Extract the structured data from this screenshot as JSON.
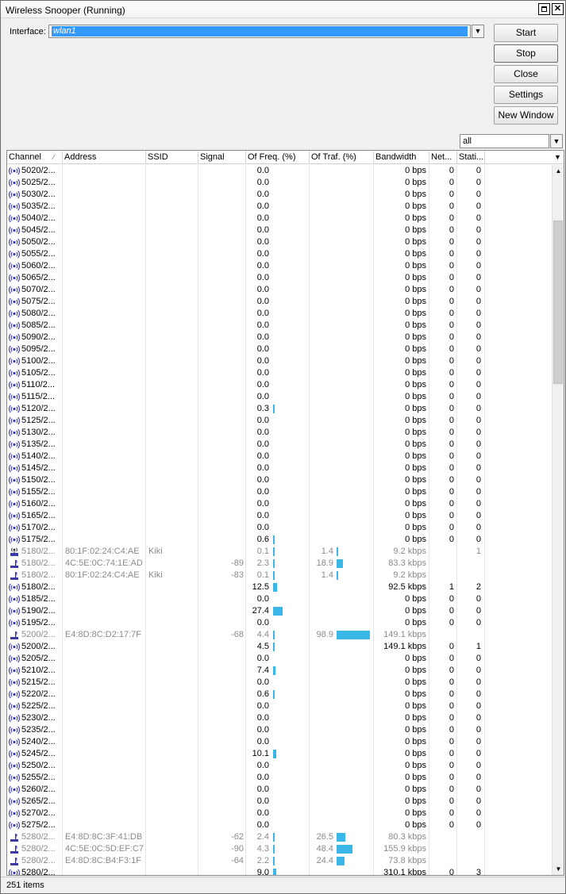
{
  "window": {
    "title": "Wireless Snooper (Running)",
    "interface_label": "Interface:",
    "interface_value": "wlan1",
    "filter_value": "all",
    "status": "251 items"
  },
  "buttons": {
    "start": "Start",
    "stop": "Stop",
    "close": "Close",
    "settings": "Settings",
    "new_window": "New Window"
  },
  "columns": [
    "Channel",
    "Address",
    "SSID",
    "Signal",
    "Of Freq. (%)",
    "Of Traf. (%)",
    "Bandwidth",
    "Net...",
    "Stati..."
  ],
  "colors": {
    "bar": "#3ab7e6",
    "selection": "#3399ff",
    "dim_text": "#8a8a8a"
  },
  "icons": {
    "channel": "antenna-icon",
    "access_point": "access-point-icon",
    "station": "station-icon"
  },
  "rows": [
    {
      "channel": "5020/2...",
      "address": "",
      "ssid": "",
      "signal": "",
      "freq": "0.0",
      "traf": "",
      "bandwidth": "0 bps",
      "net": "0",
      "sta": "0",
      "kind": "channel"
    },
    {
      "channel": "5025/2...",
      "address": "",
      "ssid": "",
      "signal": "",
      "freq": "0.0",
      "traf": "",
      "bandwidth": "0 bps",
      "net": "0",
      "sta": "0",
      "kind": "channel"
    },
    {
      "channel": "5030/2...",
      "address": "",
      "ssid": "",
      "signal": "",
      "freq": "0.0",
      "traf": "",
      "bandwidth": "0 bps",
      "net": "0",
      "sta": "0",
      "kind": "channel"
    },
    {
      "channel": "5035/2...",
      "address": "",
      "ssid": "",
      "signal": "",
      "freq": "0.0",
      "traf": "",
      "bandwidth": "0 bps",
      "net": "0",
      "sta": "0",
      "kind": "channel"
    },
    {
      "channel": "5040/2...",
      "address": "",
      "ssid": "",
      "signal": "",
      "freq": "0.0",
      "traf": "",
      "bandwidth": "0 bps",
      "net": "0",
      "sta": "0",
      "kind": "channel"
    },
    {
      "channel": "5045/2...",
      "address": "",
      "ssid": "",
      "signal": "",
      "freq": "0.0",
      "traf": "",
      "bandwidth": "0 bps",
      "net": "0",
      "sta": "0",
      "kind": "channel"
    },
    {
      "channel": "5050/2...",
      "address": "",
      "ssid": "",
      "signal": "",
      "freq": "0.0",
      "traf": "",
      "bandwidth": "0 bps",
      "net": "0",
      "sta": "0",
      "kind": "channel"
    },
    {
      "channel": "5055/2...",
      "address": "",
      "ssid": "",
      "signal": "",
      "freq": "0.0",
      "traf": "",
      "bandwidth": "0 bps",
      "net": "0",
      "sta": "0",
      "kind": "channel"
    },
    {
      "channel": "5060/2...",
      "address": "",
      "ssid": "",
      "signal": "",
      "freq": "0.0",
      "traf": "",
      "bandwidth": "0 bps",
      "net": "0",
      "sta": "0",
      "kind": "channel"
    },
    {
      "channel": "5065/2...",
      "address": "",
      "ssid": "",
      "signal": "",
      "freq": "0.0",
      "traf": "",
      "bandwidth": "0 bps",
      "net": "0",
      "sta": "0",
      "kind": "channel"
    },
    {
      "channel": "5070/2...",
      "address": "",
      "ssid": "",
      "signal": "",
      "freq": "0.0",
      "traf": "",
      "bandwidth": "0 bps",
      "net": "0",
      "sta": "0",
      "kind": "channel"
    },
    {
      "channel": "5075/2...",
      "address": "",
      "ssid": "",
      "signal": "",
      "freq": "0.0",
      "traf": "",
      "bandwidth": "0 bps",
      "net": "0",
      "sta": "0",
      "kind": "channel"
    },
    {
      "channel": "5080/2...",
      "address": "",
      "ssid": "",
      "signal": "",
      "freq": "0.0",
      "traf": "",
      "bandwidth": "0 bps",
      "net": "0",
      "sta": "0",
      "kind": "channel"
    },
    {
      "channel": "5085/2...",
      "address": "",
      "ssid": "",
      "signal": "",
      "freq": "0.0",
      "traf": "",
      "bandwidth": "0 bps",
      "net": "0",
      "sta": "0",
      "kind": "channel"
    },
    {
      "channel": "5090/2...",
      "address": "",
      "ssid": "",
      "signal": "",
      "freq": "0.0",
      "traf": "",
      "bandwidth": "0 bps",
      "net": "0",
      "sta": "0",
      "kind": "channel"
    },
    {
      "channel": "5095/2...",
      "address": "",
      "ssid": "",
      "signal": "",
      "freq": "0.0",
      "traf": "",
      "bandwidth": "0 bps",
      "net": "0",
      "sta": "0",
      "kind": "channel"
    },
    {
      "channel": "5100/2...",
      "address": "",
      "ssid": "",
      "signal": "",
      "freq": "0.0",
      "traf": "",
      "bandwidth": "0 bps",
      "net": "0",
      "sta": "0",
      "kind": "channel"
    },
    {
      "channel": "5105/2...",
      "address": "",
      "ssid": "",
      "signal": "",
      "freq": "0.0",
      "traf": "",
      "bandwidth": "0 bps",
      "net": "0",
      "sta": "0",
      "kind": "channel"
    },
    {
      "channel": "5110/2...",
      "address": "",
      "ssid": "",
      "signal": "",
      "freq": "0.0",
      "traf": "",
      "bandwidth": "0 bps",
      "net": "0",
      "sta": "0",
      "kind": "channel"
    },
    {
      "channel": "5115/2...",
      "address": "",
      "ssid": "",
      "signal": "",
      "freq": "0.0",
      "traf": "",
      "bandwidth": "0 bps",
      "net": "0",
      "sta": "0",
      "kind": "channel"
    },
    {
      "channel": "5120/2...",
      "address": "",
      "ssid": "",
      "signal": "",
      "freq": "0.3",
      "traf": "",
      "bandwidth": "0 bps",
      "net": "0",
      "sta": "0",
      "kind": "channel"
    },
    {
      "channel": "5125/2...",
      "address": "",
      "ssid": "",
      "signal": "",
      "freq": "0.0",
      "traf": "",
      "bandwidth": "0 bps",
      "net": "0",
      "sta": "0",
      "kind": "channel"
    },
    {
      "channel": "5130/2...",
      "address": "",
      "ssid": "",
      "signal": "",
      "freq": "0.0",
      "traf": "",
      "bandwidth": "0 bps",
      "net": "0",
      "sta": "0",
      "kind": "channel"
    },
    {
      "channel": "5135/2...",
      "address": "",
      "ssid": "",
      "signal": "",
      "freq": "0.0",
      "traf": "",
      "bandwidth": "0 bps",
      "net": "0",
      "sta": "0",
      "kind": "channel"
    },
    {
      "channel": "5140/2...",
      "address": "",
      "ssid": "",
      "signal": "",
      "freq": "0.0",
      "traf": "",
      "bandwidth": "0 bps",
      "net": "0",
      "sta": "0",
      "kind": "channel"
    },
    {
      "channel": "5145/2...",
      "address": "",
      "ssid": "",
      "signal": "",
      "freq": "0.0",
      "traf": "",
      "bandwidth": "0 bps",
      "net": "0",
      "sta": "0",
      "kind": "channel"
    },
    {
      "channel": "5150/2...",
      "address": "",
      "ssid": "",
      "signal": "",
      "freq": "0.0",
      "traf": "",
      "bandwidth": "0 bps",
      "net": "0",
      "sta": "0",
      "kind": "channel"
    },
    {
      "channel": "5155/2...",
      "address": "",
      "ssid": "",
      "signal": "",
      "freq": "0.0",
      "traf": "",
      "bandwidth": "0 bps",
      "net": "0",
      "sta": "0",
      "kind": "channel"
    },
    {
      "channel": "5160/2...",
      "address": "",
      "ssid": "",
      "signal": "",
      "freq": "0.0",
      "traf": "",
      "bandwidth": "0 bps",
      "net": "0",
      "sta": "0",
      "kind": "channel"
    },
    {
      "channel": "5165/2...",
      "address": "",
      "ssid": "",
      "signal": "",
      "freq": "0.0",
      "traf": "",
      "bandwidth": "0 bps",
      "net": "0",
      "sta": "0",
      "kind": "channel"
    },
    {
      "channel": "5170/2...",
      "address": "",
      "ssid": "",
      "signal": "",
      "freq": "0.0",
      "traf": "",
      "bandwidth": "0 bps",
      "net": "0",
      "sta": "0",
      "kind": "channel"
    },
    {
      "channel": "5175/2...",
      "address": "",
      "ssid": "",
      "signal": "",
      "freq": "0.6",
      "traf": "",
      "bandwidth": "0 bps",
      "net": "0",
      "sta": "0",
      "kind": "channel"
    },
    {
      "channel": "5180/2...",
      "address": "80:1F:02:24:C4:AE",
      "ssid": "Kiki",
      "signal": "",
      "freq": "0.1",
      "traf": "1.4",
      "bandwidth": "9.2 kbps",
      "net": "",
      "sta": "1",
      "kind": "ap",
      "dim": true
    },
    {
      "channel": "5180/2...",
      "address": "4C:5E:0C:74:1E:AD",
      "ssid": "",
      "signal": "-89",
      "freq": "2.3",
      "traf": "18.9",
      "bandwidth": "83.3 kbps",
      "net": "",
      "sta": "",
      "kind": "station",
      "dim": true
    },
    {
      "channel": "5180/2...",
      "address": "80:1F:02:24:C4:AE",
      "ssid": "Kiki",
      "signal": "-83",
      "freq": "0.1",
      "traf": "1.4",
      "bandwidth": "9.2 kbps",
      "net": "",
      "sta": "",
      "kind": "station",
      "dim": true
    },
    {
      "channel": "5180/2...",
      "address": "",
      "ssid": "",
      "signal": "",
      "freq": "12.5",
      "traf": "",
      "bandwidth": "92.5 kbps",
      "net": "1",
      "sta": "2",
      "kind": "channel"
    },
    {
      "channel": "5185/2...",
      "address": "",
      "ssid": "",
      "signal": "",
      "freq": "0.0",
      "traf": "",
      "bandwidth": "0 bps",
      "net": "0",
      "sta": "0",
      "kind": "channel"
    },
    {
      "channel": "5190/2...",
      "address": "",
      "ssid": "",
      "signal": "",
      "freq": "27.4",
      "traf": "",
      "bandwidth": "0 bps",
      "net": "0",
      "sta": "0",
      "kind": "channel"
    },
    {
      "channel": "5195/2...",
      "address": "",
      "ssid": "",
      "signal": "",
      "freq": "0.0",
      "traf": "",
      "bandwidth": "0 bps",
      "net": "0",
      "sta": "0",
      "kind": "channel"
    },
    {
      "channel": "5200/2...",
      "address": "E4:8D:8C:D2:17:7F",
      "ssid": "",
      "signal": "-68",
      "freq": "4.4",
      "traf": "98.9",
      "bandwidth": "149.1 kbps",
      "net": "",
      "sta": "",
      "kind": "station",
      "dim": true
    },
    {
      "channel": "5200/2...",
      "address": "",
      "ssid": "",
      "signal": "",
      "freq": "4.5",
      "traf": "",
      "bandwidth": "149.1 kbps",
      "net": "0",
      "sta": "1",
      "kind": "channel"
    },
    {
      "channel": "5205/2...",
      "address": "",
      "ssid": "",
      "signal": "",
      "freq": "0.0",
      "traf": "",
      "bandwidth": "0 bps",
      "net": "0",
      "sta": "0",
      "kind": "channel"
    },
    {
      "channel": "5210/2...",
      "address": "",
      "ssid": "",
      "signal": "",
      "freq": "7.4",
      "traf": "",
      "bandwidth": "0 bps",
      "net": "0",
      "sta": "0",
      "kind": "channel"
    },
    {
      "channel": "5215/2...",
      "address": "",
      "ssid": "",
      "signal": "",
      "freq": "0.0",
      "traf": "",
      "bandwidth": "0 bps",
      "net": "0",
      "sta": "0",
      "kind": "channel"
    },
    {
      "channel": "5220/2...",
      "address": "",
      "ssid": "",
      "signal": "",
      "freq": "0.6",
      "traf": "",
      "bandwidth": "0 bps",
      "net": "0",
      "sta": "0",
      "kind": "channel"
    },
    {
      "channel": "5225/2...",
      "address": "",
      "ssid": "",
      "signal": "",
      "freq": "0.0",
      "traf": "",
      "bandwidth": "0 bps",
      "net": "0",
      "sta": "0",
      "kind": "channel"
    },
    {
      "channel": "5230/2...",
      "address": "",
      "ssid": "",
      "signal": "",
      "freq": "0.0",
      "traf": "",
      "bandwidth": "0 bps",
      "net": "0",
      "sta": "0",
      "kind": "channel"
    },
    {
      "channel": "5235/2...",
      "address": "",
      "ssid": "",
      "signal": "",
      "freq": "0.0",
      "traf": "",
      "bandwidth": "0 bps",
      "net": "0",
      "sta": "0",
      "kind": "channel"
    },
    {
      "channel": "5240/2...",
      "address": "",
      "ssid": "",
      "signal": "",
      "freq": "0.0",
      "traf": "",
      "bandwidth": "0 bps",
      "net": "0",
      "sta": "0",
      "kind": "channel"
    },
    {
      "channel": "5245/2...",
      "address": "",
      "ssid": "",
      "signal": "",
      "freq": "10.1",
      "traf": "",
      "bandwidth": "0 bps",
      "net": "0",
      "sta": "0",
      "kind": "channel"
    },
    {
      "channel": "5250/2...",
      "address": "",
      "ssid": "",
      "signal": "",
      "freq": "0.0",
      "traf": "",
      "bandwidth": "0 bps",
      "net": "0",
      "sta": "0",
      "kind": "channel"
    },
    {
      "channel": "5255/2...",
      "address": "",
      "ssid": "",
      "signal": "",
      "freq": "0.0",
      "traf": "",
      "bandwidth": "0 bps",
      "net": "0",
      "sta": "0",
      "kind": "channel"
    },
    {
      "channel": "5260/2...",
      "address": "",
      "ssid": "",
      "signal": "",
      "freq": "0.0",
      "traf": "",
      "bandwidth": "0 bps",
      "net": "0",
      "sta": "0",
      "kind": "channel"
    },
    {
      "channel": "5265/2...",
      "address": "",
      "ssid": "",
      "signal": "",
      "freq": "0.0",
      "traf": "",
      "bandwidth": "0 bps",
      "net": "0",
      "sta": "0",
      "kind": "channel"
    },
    {
      "channel": "5270/2...",
      "address": "",
      "ssid": "",
      "signal": "",
      "freq": "0.0",
      "traf": "",
      "bandwidth": "0 bps",
      "net": "0",
      "sta": "0",
      "kind": "channel"
    },
    {
      "channel": "5275/2...",
      "address": "",
      "ssid": "",
      "signal": "",
      "freq": "0.0",
      "traf": "",
      "bandwidth": "0 bps",
      "net": "0",
      "sta": "0",
      "kind": "channel"
    },
    {
      "channel": "5280/2...",
      "address": "E4:8D:8C:3F:41:DB",
      "ssid": "",
      "signal": "-62",
      "freq": "2.4",
      "traf": "26.5",
      "bandwidth": "80.3 kbps",
      "net": "",
      "sta": "",
      "kind": "station",
      "dim": true
    },
    {
      "channel": "5280/2...",
      "address": "4C:5E:0C:5D:EF:C7",
      "ssid": "",
      "signal": "-90",
      "freq": "4.3",
      "traf": "48.4",
      "bandwidth": "155.9 kbps",
      "net": "",
      "sta": "",
      "kind": "station",
      "dim": true
    },
    {
      "channel": "5280/2...",
      "address": "E4:8D:8C:B4:F3:1F",
      "ssid": "",
      "signal": "-64",
      "freq": "2.2",
      "traf": "24.4",
      "bandwidth": "73.8 kbps",
      "net": "",
      "sta": "",
      "kind": "station",
      "dim": true
    },
    {
      "channel": "5280/2...",
      "address": "",
      "ssid": "",
      "signal": "",
      "freq": "9.0",
      "traf": "",
      "bandwidth": "310.1 kbps",
      "net": "0",
      "sta": "3",
      "kind": "channel"
    }
  ]
}
